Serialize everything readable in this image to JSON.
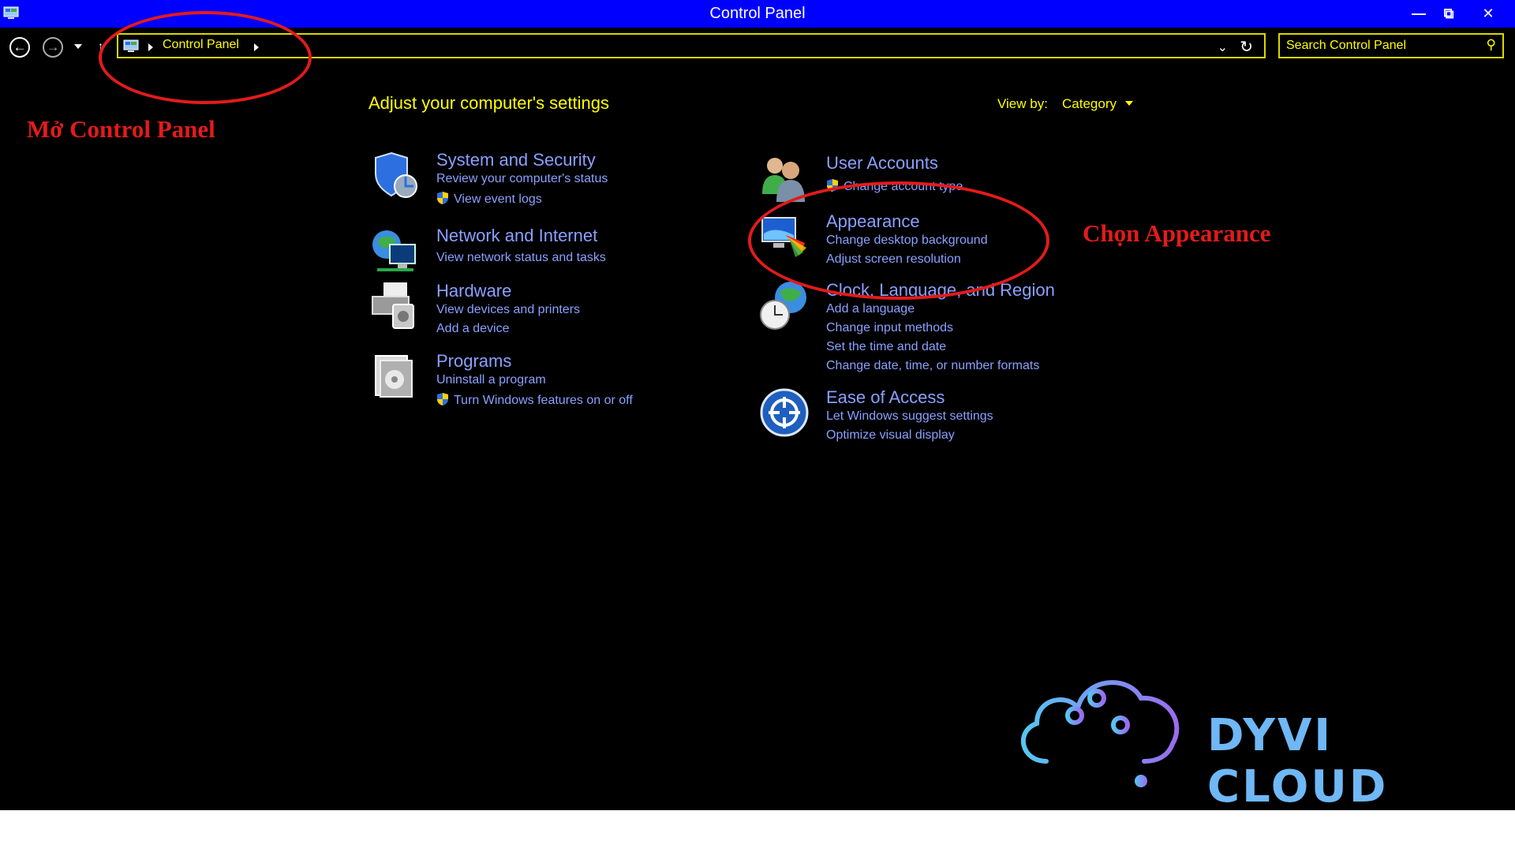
{
  "window": {
    "title": "Control Panel"
  },
  "titlebar_buttons": {
    "minimize": "—",
    "maximize": "⧉",
    "close": "✕"
  },
  "address": {
    "path": "Control Panel"
  },
  "search": {
    "placeholder": "Search Control Panel"
  },
  "main": {
    "heading": "Adjust your computer's settings",
    "view_by_label": "View by:",
    "view_by_value": "Category"
  },
  "categories": [
    {
      "title": "System and Security",
      "icon": "shield-icon",
      "links": [
        {
          "text": "Review your computer's status",
          "shield": false
        },
        {
          "text": "View event logs",
          "shield": true
        }
      ]
    },
    {
      "title": "Network and Internet",
      "icon": "network-globe-icon",
      "links": [
        {
          "text": "View network status and tasks",
          "shield": false
        }
      ]
    },
    {
      "title": "Hardware",
      "icon": "printer-icon",
      "links": [
        {
          "text": "View devices and printers",
          "shield": false
        },
        {
          "text": "Add a device",
          "shield": false
        }
      ]
    },
    {
      "title": "Programs",
      "icon": "programs-icon",
      "links": [
        {
          "text": "Uninstall a program",
          "shield": false
        },
        {
          "text": "Turn Windows features on or off",
          "shield": true
        }
      ]
    },
    {
      "title": "User Accounts",
      "icon": "users-icon",
      "links": [
        {
          "text": "Change account type",
          "shield": true
        }
      ]
    },
    {
      "title": "Appearance",
      "icon": "monitor-palette-icon",
      "links": [
        {
          "text": "Change desktop background",
          "shield": false
        },
        {
          "text": "Adjust screen resolution",
          "shield": false
        }
      ]
    },
    {
      "title": "Clock, Language, and Region",
      "icon": "clock-globe-icon",
      "links": [
        {
          "text": "Add a language",
          "shield": false
        },
        {
          "text": "Change input methods",
          "shield": false
        },
        {
          "text": "Set the time and date",
          "shield": false
        },
        {
          "text": "Change date, time, or number formats",
          "shield": false
        }
      ]
    },
    {
      "title": "Ease of Access",
      "icon": "ease-of-access-icon",
      "links": [
        {
          "text": "Let Windows suggest settings",
          "shield": false
        },
        {
          "text": "Optimize visual display",
          "shield": false
        }
      ]
    }
  ],
  "annotations": {
    "open_control_panel": "Mở Control Panel",
    "choose_appearance": "Chọn Appearance"
  },
  "brand": {
    "name": "DYVI CLOUD"
  },
  "colors": {
    "titlebar": "#0000ff",
    "background": "#000000",
    "link": "#8aa0ff",
    "highlight": "#ffff00",
    "annotation": "#e31b1b",
    "brand": "#6fb8f5"
  }
}
